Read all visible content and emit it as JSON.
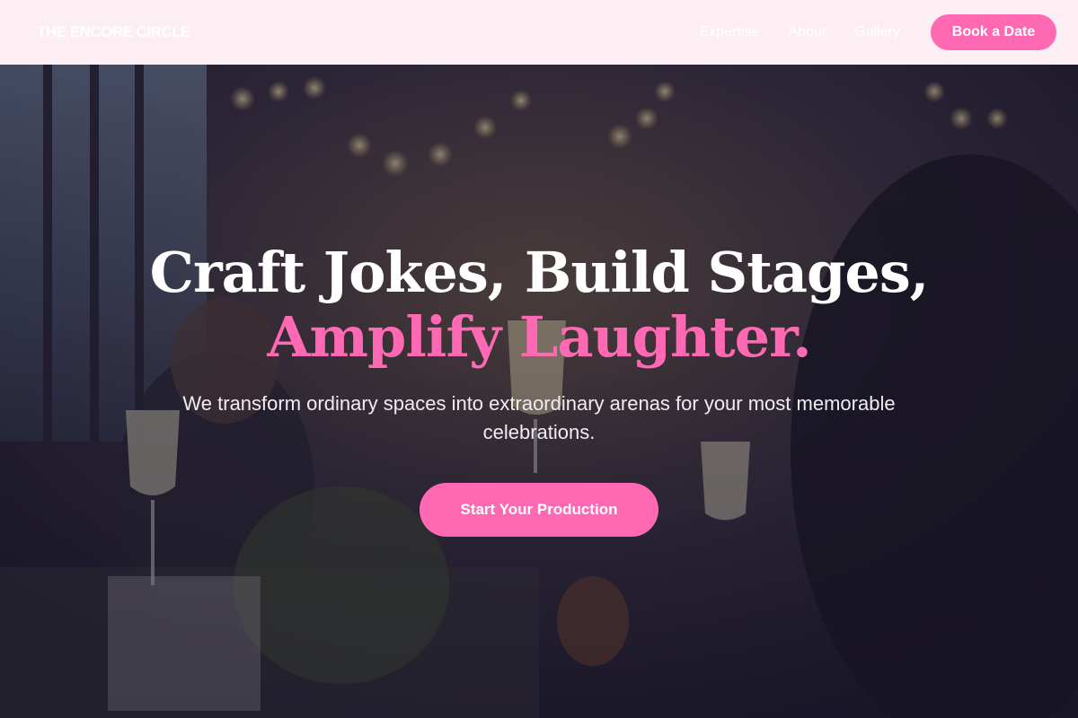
{
  "header": {
    "logo": "THE ENCORE CIRCLE",
    "nav": [
      {
        "label": "Expertise"
      },
      {
        "label": "About"
      },
      {
        "label": "Gallery"
      }
    ],
    "cta_label": "Book a Date"
  },
  "hero": {
    "headline_line1": "Craft Jokes, Build Stages,",
    "headline_line2": "Amplify Laughter.",
    "subtitle": "We transform ordinary spaces into extraordinary arenas for your most memorable celebrations.",
    "cta_label": "Start Your Production"
  },
  "colors": {
    "accent": "#ff69b4",
    "header_bg": "#fdeef4",
    "white": "#ffffff"
  }
}
